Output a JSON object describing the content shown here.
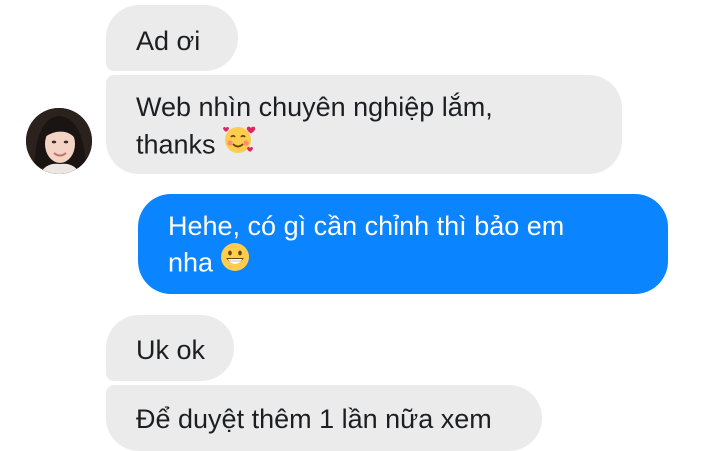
{
  "conversation": {
    "messages": [
      {
        "from": "them",
        "lines": [
          "Ad ơi"
        ]
      },
      {
        "from": "them",
        "lines": [
          "Web nhìn chuyên nghiệp lắm,",
          "thanks"
        ],
        "emoji": "smiling-face-with-hearts"
      },
      {
        "from": "me",
        "lines": [
          "Hehe, có gì cần chỉnh thì bảo em",
          "nha"
        ],
        "emoji": "grinning-face"
      },
      {
        "from": "them",
        "lines": [
          "Uk ok"
        ]
      },
      {
        "from": "them",
        "lines": [
          "Để duyệt thêm 1 lần nữa xem"
        ]
      }
    ]
  },
  "colors": {
    "incoming_bubble": "#ebebeb",
    "outgoing_bubble": "#0a84ff",
    "incoming_text": "#1c1e21",
    "outgoing_text": "#ffffff"
  }
}
